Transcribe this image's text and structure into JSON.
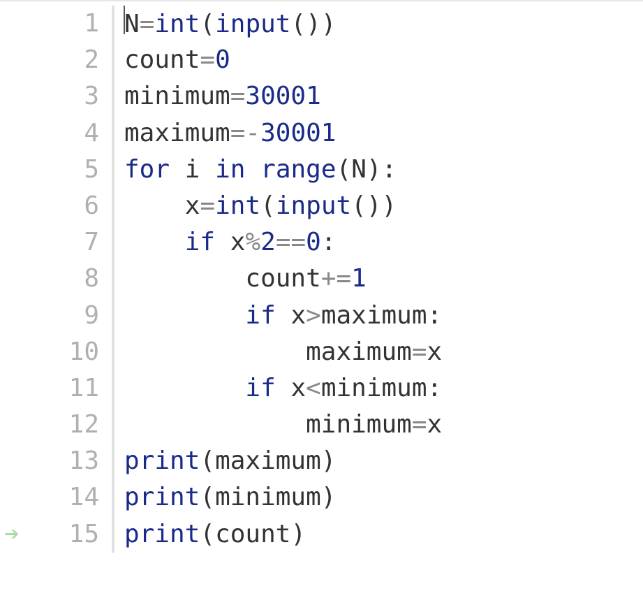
{
  "editor": {
    "cursor_line": 1,
    "arrow_line": 15,
    "lines": [
      {
        "n": 1,
        "indent": 0,
        "tokens": [
          {
            "t": "N",
            "c": "id"
          },
          {
            "t": "=",
            "c": "op"
          },
          {
            "t": "int",
            "c": "func"
          },
          {
            "t": "(",
            "c": "punc"
          },
          {
            "t": "input",
            "c": "func"
          },
          {
            "t": "(",
            "c": "punc"
          },
          {
            "t": ")",
            "c": "punc"
          },
          {
            "t": ")",
            "c": "punc"
          }
        ]
      },
      {
        "n": 2,
        "indent": 0,
        "tokens": [
          {
            "t": "count",
            "c": "id"
          },
          {
            "t": "=",
            "c": "op"
          },
          {
            "t": "0",
            "c": "num"
          }
        ]
      },
      {
        "n": 3,
        "indent": 0,
        "tokens": [
          {
            "t": "minimum",
            "c": "id"
          },
          {
            "t": "=",
            "c": "op"
          },
          {
            "t": "30001",
            "c": "num"
          }
        ]
      },
      {
        "n": 4,
        "indent": 0,
        "tokens": [
          {
            "t": "maximum",
            "c": "id"
          },
          {
            "t": "=",
            "c": "op"
          },
          {
            "t": "-",
            "c": "op"
          },
          {
            "t": "30001",
            "c": "num"
          }
        ]
      },
      {
        "n": 5,
        "indent": 0,
        "tokens": [
          {
            "t": "for",
            "c": "kw"
          },
          {
            "t": " ",
            "c": "sp"
          },
          {
            "t": "i",
            "c": "id"
          },
          {
            "t": " ",
            "c": "sp"
          },
          {
            "t": "in",
            "c": "kw"
          },
          {
            "t": " ",
            "c": "sp"
          },
          {
            "t": "range",
            "c": "func"
          },
          {
            "t": "(",
            "c": "punc"
          },
          {
            "t": "N",
            "c": "id"
          },
          {
            "t": ")",
            "c": "punc"
          },
          {
            "t": ":",
            "c": "punc"
          }
        ]
      },
      {
        "n": 6,
        "indent": 4,
        "tokens": [
          {
            "t": "x",
            "c": "id"
          },
          {
            "t": "=",
            "c": "op"
          },
          {
            "t": "int",
            "c": "func"
          },
          {
            "t": "(",
            "c": "punc"
          },
          {
            "t": "input",
            "c": "func"
          },
          {
            "t": "(",
            "c": "punc"
          },
          {
            "t": ")",
            "c": "punc"
          },
          {
            "t": ")",
            "c": "punc"
          }
        ]
      },
      {
        "n": 7,
        "indent": 4,
        "tokens": [
          {
            "t": "if",
            "c": "kw"
          },
          {
            "t": " ",
            "c": "sp"
          },
          {
            "t": "x",
            "c": "id"
          },
          {
            "t": "%",
            "c": "op"
          },
          {
            "t": "2",
            "c": "num"
          },
          {
            "t": "==",
            "c": "op"
          },
          {
            "t": "0",
            "c": "num"
          },
          {
            "t": ":",
            "c": "punc"
          }
        ]
      },
      {
        "n": 8,
        "indent": 8,
        "tokens": [
          {
            "t": "count",
            "c": "id"
          },
          {
            "t": "+=",
            "c": "op"
          },
          {
            "t": "1",
            "c": "num"
          }
        ]
      },
      {
        "n": 9,
        "indent": 8,
        "tokens": [
          {
            "t": "if",
            "c": "kw"
          },
          {
            "t": " ",
            "c": "sp"
          },
          {
            "t": "x",
            "c": "id"
          },
          {
            "t": ">",
            "c": "op"
          },
          {
            "t": "maximum",
            "c": "id"
          },
          {
            "t": ":",
            "c": "punc"
          }
        ]
      },
      {
        "n": 10,
        "indent": 12,
        "tokens": [
          {
            "t": "maximum",
            "c": "id"
          },
          {
            "t": "=",
            "c": "op"
          },
          {
            "t": "x",
            "c": "id"
          }
        ]
      },
      {
        "n": 11,
        "indent": 8,
        "tokens": [
          {
            "t": "if",
            "c": "kw"
          },
          {
            "t": " ",
            "c": "sp"
          },
          {
            "t": "x",
            "c": "id"
          },
          {
            "t": "<",
            "c": "op"
          },
          {
            "t": "minimum",
            "c": "id"
          },
          {
            "t": ":",
            "c": "punc"
          }
        ]
      },
      {
        "n": 12,
        "indent": 12,
        "tokens": [
          {
            "t": "minimum",
            "c": "id"
          },
          {
            "t": "=",
            "c": "op"
          },
          {
            "t": "x",
            "c": "id"
          }
        ]
      },
      {
        "n": 13,
        "indent": 0,
        "tokens": [
          {
            "t": "print",
            "c": "func"
          },
          {
            "t": "(",
            "c": "punc"
          },
          {
            "t": "maximum",
            "c": "id"
          },
          {
            "t": ")",
            "c": "punc"
          }
        ]
      },
      {
        "n": 14,
        "indent": 0,
        "tokens": [
          {
            "t": "print",
            "c": "func"
          },
          {
            "t": "(",
            "c": "punc"
          },
          {
            "t": "minimum",
            "c": "id"
          },
          {
            "t": ")",
            "c": "punc"
          }
        ]
      },
      {
        "n": 15,
        "indent": 0,
        "tokens": [
          {
            "t": "print",
            "c": "func"
          },
          {
            "t": "(",
            "c": "punc"
          },
          {
            "t": "count",
            "c": "id"
          },
          {
            "t": ")",
            "c": "punc"
          }
        ]
      }
    ]
  }
}
